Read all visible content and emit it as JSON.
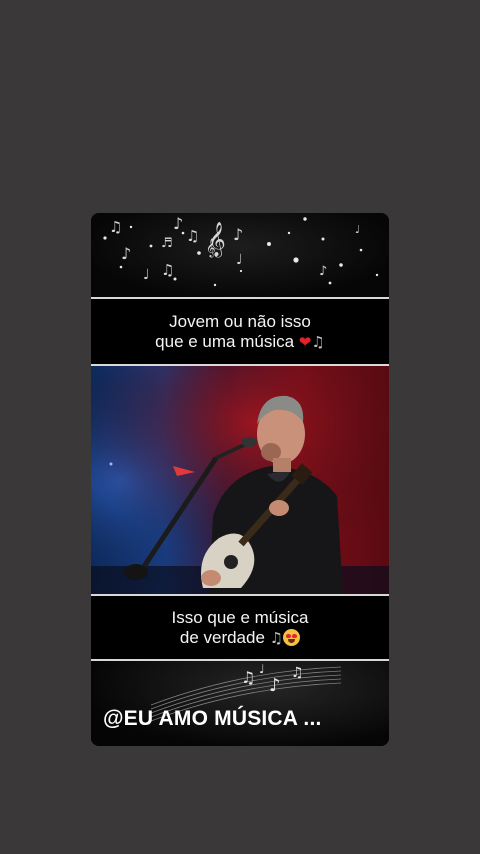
{
  "caption_top": {
    "line1": "Jovem ou não isso",
    "line2": "que e uma música",
    "emojis": [
      "heart-emoji",
      "music-notes-emoji"
    ]
  },
  "caption_bottom": {
    "line1": "Isso que e música",
    "line2": "de verdade",
    "emojis": [
      "music-notes-emoji",
      "heart-eyes-emoji"
    ]
  },
  "watermark": "@EU AMO MÚSICA ...",
  "colors": {
    "background": "#3a3839",
    "caption_bg": "#000000",
    "heart": "#e0242c",
    "stage_blue": "#1a3f86",
    "stage_red": "#7a0f18"
  }
}
